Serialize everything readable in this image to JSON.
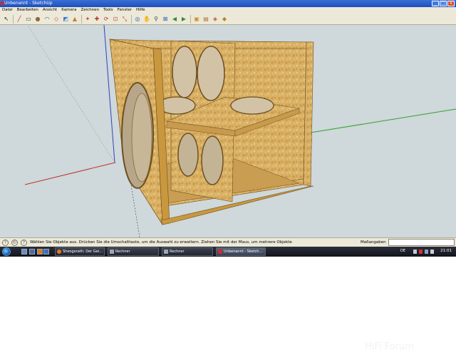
{
  "window": {
    "title": "Unbenannt - SketchUp"
  },
  "window_buttons": [
    "_",
    "□",
    "x"
  ],
  "menu": [
    "Datei",
    "Bearbeiten",
    "Ansicht",
    "Kamera",
    "Zeichnen",
    "Tools",
    "Fenster",
    "Hilfe"
  ],
  "toolbar": {
    "tools": [
      {
        "name": "select-icon",
        "glyph": "↖",
        "color": "#222222"
      },
      {
        "name": "line-icon",
        "glyph": "╱",
        "color": "#b03030"
      },
      {
        "name": "rectangle-icon",
        "glyph": "▭",
        "color": "#444444"
      },
      {
        "name": "circle-icon",
        "glyph": "●",
        "color": "#8a6a40"
      },
      {
        "name": "arc-icon",
        "glyph": "◠",
        "color": "#555555"
      },
      {
        "name": "eraser-icon",
        "glyph": "◇",
        "color": "#c04060"
      },
      {
        "name": "paint-bucket-icon",
        "glyph": "◩",
        "color": "#3a7ad0"
      },
      {
        "name": "push-pull-icon",
        "glyph": "▲",
        "color": "#c08030"
      },
      {
        "name": "follow-me-icon",
        "glyph": "✦",
        "color": "#c05030"
      },
      {
        "name": "move-icon",
        "glyph": "✚",
        "color": "#c03030"
      },
      {
        "name": "rotate-icon",
        "glyph": "⟳",
        "color": "#c03030"
      },
      {
        "name": "offset-icon",
        "glyph": "⊡",
        "color": "#c05050"
      },
      {
        "name": "scale-icon",
        "glyph": "⤡",
        "color": "#c03030"
      },
      {
        "name": "orbit-icon",
        "glyph": "◎",
        "color": "#3060b0"
      },
      {
        "name": "pan-icon",
        "glyph": "✋",
        "color": "#777777"
      },
      {
        "name": "zoom-icon",
        "glyph": "⚲",
        "color": "#444444"
      },
      {
        "name": "zoom-extents-icon",
        "glyph": "⊠",
        "color": "#3060b0"
      },
      {
        "name": "previous-view-icon",
        "glyph": "◀",
        "color": "#3a8a3a"
      },
      {
        "name": "next-view-icon",
        "glyph": "▶",
        "color": "#3a8a3a"
      },
      {
        "name": "get-models-icon",
        "glyph": "▣",
        "color": "#d09030"
      },
      {
        "name": "share-model-icon",
        "glyph": "▤",
        "color": "#b07030"
      },
      {
        "name": "share-component-icon",
        "glyph": "◈",
        "color": "#b06030"
      },
      {
        "name": "ruby-icon",
        "glyph": "◆",
        "color": "#c08030"
      }
    ]
  },
  "status": {
    "text": "Wählen Sie Objekte aus. Drücken Sie die Umschalttaste, um die Auswahl zu erweitern. Ziehen Sie mit der Maus, um mehrere Objekte",
    "measure_label": "Maßangaben",
    "measure_value": ""
  },
  "taskbar": {
    "tasks": [
      {
        "label": "Sheogorath: Der Gei...",
        "active": false
      },
      {
        "label": "Rechner",
        "active": false
      },
      {
        "label": "Rechner",
        "active": false
      },
      {
        "label": "Unbenannt - Sketch...",
        "active": true
      }
    ],
    "lang": "DE",
    "clock": "21:01"
  },
  "colors": {
    "viewport_bg": "#cfd8da",
    "wood": "#d9b064",
    "axis_red": "#c03030",
    "axis_green": "#30a030",
    "axis_blue": "#3040c0"
  }
}
